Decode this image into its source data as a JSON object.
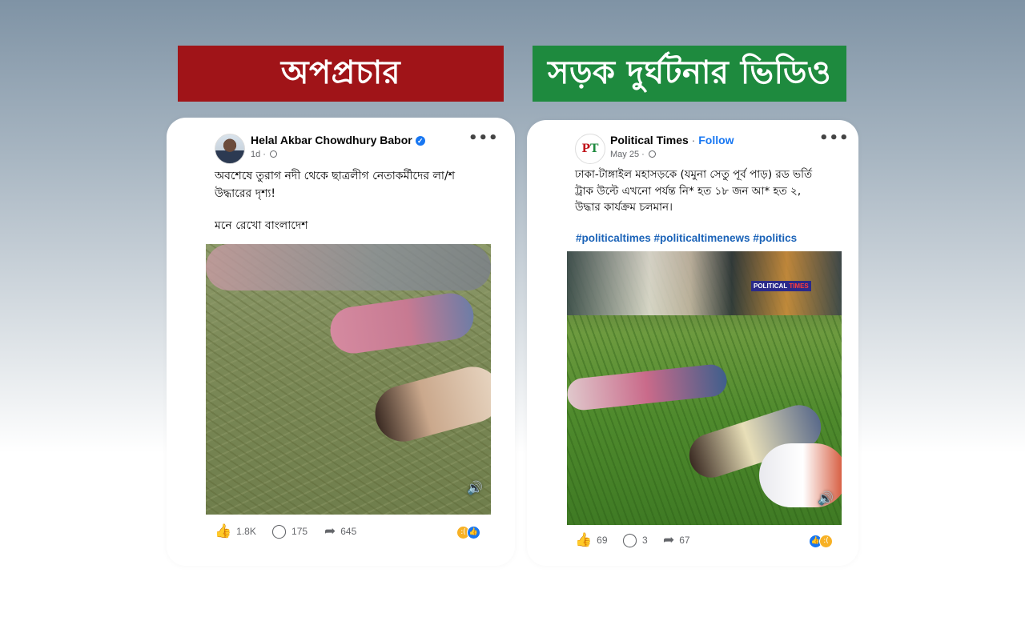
{
  "banners": {
    "left": "অপপ্রচার",
    "right": "সড়ক দুর্ঘটনার ভিডিও"
  },
  "left_post": {
    "author": "Helal Akbar Chowdhury Babor",
    "verified": true,
    "time": "1d",
    "text_line1": "অবশেষে তুরাগ নদী থেকে ছাত্রলীগ নেতাকর্মীদের লা/শ",
    "text_line2": "উদ্ধারের দৃশ্য!",
    "text_line3": "মনে রেখো বাংলাদেশ",
    "likes": "1.8K",
    "comments": "175",
    "shares": "645",
    "reactions": [
      "sad",
      "like"
    ]
  },
  "right_post": {
    "author": "Political Times",
    "follow": "Follow",
    "time": "May 25",
    "text_line1": "ঢাকা-টাঙ্গাইল মহাসড়কে (যমুনা সেতু পূর্ব পাড়) রড ভর্তি",
    "text_line2": "ট্রাক উল্টে এখনো পর্যন্ত  নি* হত ১৮ জন আ* হত ২,",
    "text_line3": "উদ্ধার কার্যক্রম চলমান।",
    "hashtags": "#politicaltimes #politicaltimenews #politics",
    "watermark_a": "POLITICAL",
    "watermark_b": "TIMES",
    "likes": "69",
    "comments": "3",
    "shares": "67",
    "reactions": [
      "like",
      "sad"
    ]
  },
  "icons": {
    "more": "more-options-icon",
    "like": "thumbs-up-icon",
    "comment": "comment-icon",
    "share": "share-icon",
    "speaker": "speaker-icon",
    "globe": "globe-icon",
    "verified": "verified-badge-icon"
  },
  "colors": {
    "banner_red": "#a01418",
    "banner_green": "#1e8a3e",
    "link_blue": "#1877f2",
    "hashtag_blue": "#1b63b8"
  }
}
